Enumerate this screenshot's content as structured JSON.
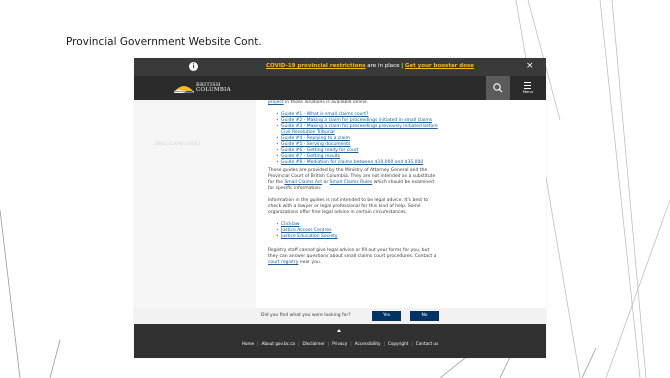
{
  "slide": {
    "title": "Provincial Government Website Cont."
  },
  "banner": {
    "info_glyph": "i",
    "link1": "COVID-19 provincial restrictions",
    "middle": " are in place | ",
    "link2": "Get your booster dose",
    "close_glyph": "×"
  },
  "header": {
    "logo_line1": "BRITISH",
    "logo_line2": "COLUMBIA",
    "menu_label": "Menu"
  },
  "sidebar": {
    "faint_text": "SMALL CLAIMS GUIDES"
  },
  "content": {
    "top_link": "project",
    "top_rest": " in those locations is available online.",
    "guides": [
      "Guide #1 - What is small claims court?",
      "Guide #2 - Making a claim for proceedings initiated in small claims",
      "Guide #3 - Making a claim for proceedings previously initiated before",
      "Civil Resolution Tribunal",
      "Guide #4 - Replying to a claim",
      "Guide #5 - Serving documents",
      "Guide #6 - Getting ready for court",
      "Guide #7 - Getting results",
      "Guide #8 - Mediation for claims between $10,000 and $35,000"
    ],
    "para1": [
      "These guides are provided by the Ministry of Attorney General and the",
      "Provincial Court of British Columbia. They are not intended as a substitute",
      "for the ",
      "Small Claims Act",
      " or ",
      "Small Claims Rules",
      " which should be examined",
      "for specific information."
    ],
    "para2": [
      "Information in the guides is not intended to be legal advice. It's best to",
      "check with a lawyer or legal professional for this kind of help. Some",
      "organizations offer free legal advice in certain circumstances."
    ],
    "resources": [
      "Clicklaw",
      "Justice Access Centres",
      "Justice Education Society"
    ],
    "para3": [
      "Registry staff cannot give legal advice or fill out your forms for you, but",
      "they can answer questions about small claims court procedures. Contact a",
      "court registry",
      " near you."
    ]
  },
  "feedback": {
    "question": "Did you find what you were looking for?",
    "yes": "Yes",
    "no": "No"
  },
  "footer": {
    "links": [
      "Home",
      "About gov.bc.ca",
      "Disclaimer",
      "Privacy",
      "Accessibility",
      "Copyright",
      "Contact us"
    ],
    "separator": "|"
  },
  "colors": {
    "banner_link": "#fcba19",
    "header_bg": "#2b2b2b",
    "button": "#003366",
    "link": "#1a5a96",
    "footer_bg": "#313132"
  },
  "icons": [
    "info-icon",
    "close-icon",
    "bc-sun-logo-icon",
    "search-icon",
    "hamburger-menu-icon",
    "back-to-top-icon"
  ]
}
